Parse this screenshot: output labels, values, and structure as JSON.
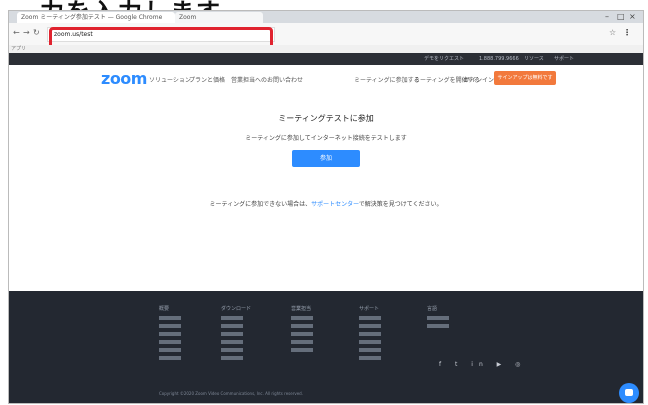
{
  "caption": "力を入力します。",
  "browser": {
    "tabs": [
      {
        "label": "Zoom ミーティング参加テスト — Google Chrome"
      },
      {
        "label": "Zoom"
      }
    ],
    "url": "zoom.us/test",
    "bookmark_label": "アプリ"
  },
  "topstrip": {
    "items": [
      "デモをリクエスト",
      "1.888.799.9666",
      "リソース",
      "サポート"
    ]
  },
  "zoomnav": {
    "logo": "zoom",
    "links": [
      "ソリューション",
      "プランと価格",
      "営業担当へのお問い合わせ"
    ],
    "right_links": [
      "ミーティングに参加する",
      "ミーティングを開催する",
      "サインイン"
    ],
    "signup": "サインアップは無料です"
  },
  "main": {
    "title": "ミーティングテストに参加",
    "subtitle": "ミーティングに参加してインターネット接続をテストします",
    "join_button": "参加",
    "note_prefix": "ミーティングに参加できない場合は、",
    "note_link": "サポートセンター",
    "note_suffix": "で解決策を見つけてください。"
  },
  "footer": {
    "columns": [
      {
        "heading": "概要",
        "items": 6
      },
      {
        "heading": "ダウンロード",
        "items": 6
      },
      {
        "heading": "営業担当",
        "items": 5
      },
      {
        "heading": "サポート",
        "items": 6
      },
      {
        "heading": "言語",
        "items": 2
      }
    ],
    "social": "f t in ▶ ◎",
    "copyright": "Copyright ©2020 Zoom Video Communications, Inc. All rights reserved."
  }
}
